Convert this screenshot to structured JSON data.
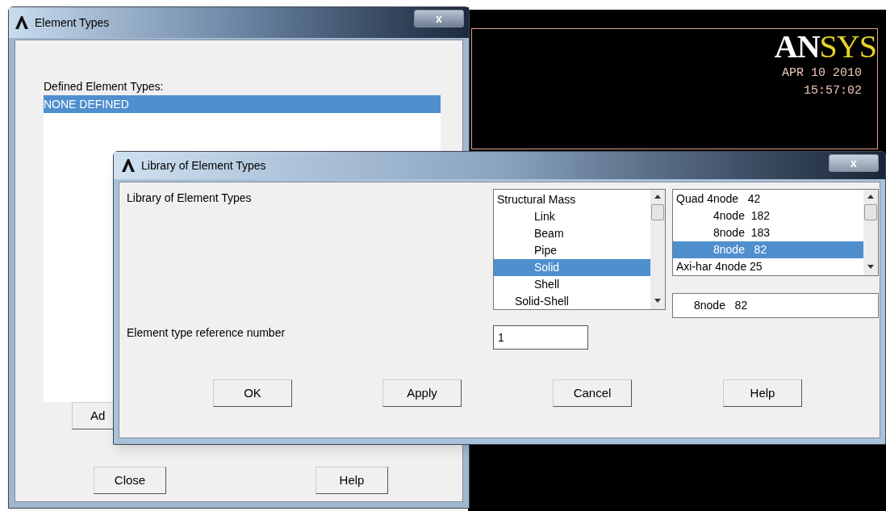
{
  "graphics": {
    "logo": {
      "white_part": "AN",
      "yellow_part": "SYS"
    },
    "date": "APR 10 2010",
    "time": "15:57:02"
  },
  "element_types_window": {
    "title": "Element Types",
    "close": "x",
    "list_label": "Defined Element Types:",
    "list": [
      {
        "label": "NONE DEFINED",
        "selected": true
      }
    ],
    "buttons": [
      "Ad",
      "Close",
      "Help"
    ]
  },
  "library_dialog": {
    "title": "Library of Element Types",
    "close": "x",
    "label": "Library of Element Types",
    "category_list": [
      {
        "label": "Structural Mass",
        "kind": "top",
        "selected": false
      },
      {
        "label": "Link",
        "kind": "sub",
        "selected": false
      },
      {
        "label": "Beam",
        "kind": "sub",
        "selected": false
      },
      {
        "label": "Pipe",
        "kind": "sub",
        "selected": false
      },
      {
        "label": "Solid",
        "kind": "sub",
        "selected": true
      },
      {
        "label": "Shell",
        "kind": "sub",
        "selected": false
      },
      {
        "label": "Solid-Shell",
        "kind": "mid",
        "selected": false
      }
    ],
    "type_list": [
      {
        "label": "Quad 4node   42",
        "kind": "top",
        "selected": false
      },
      {
        "label": "4node  182",
        "kind": "sub",
        "selected": false
      },
      {
        "label": "8node  183",
        "kind": "sub",
        "selected": false
      },
      {
        "label": "8node   82",
        "kind": "sub",
        "selected": true
      },
      {
        "label": "Axi-har 4node 25",
        "kind": "top",
        "selected": false
      }
    ],
    "selected_type": "8node   82",
    "reference_label": "Element type reference number",
    "reference_value": "1",
    "buttons": [
      "OK",
      "Apply",
      "Cancel",
      "Help"
    ]
  }
}
